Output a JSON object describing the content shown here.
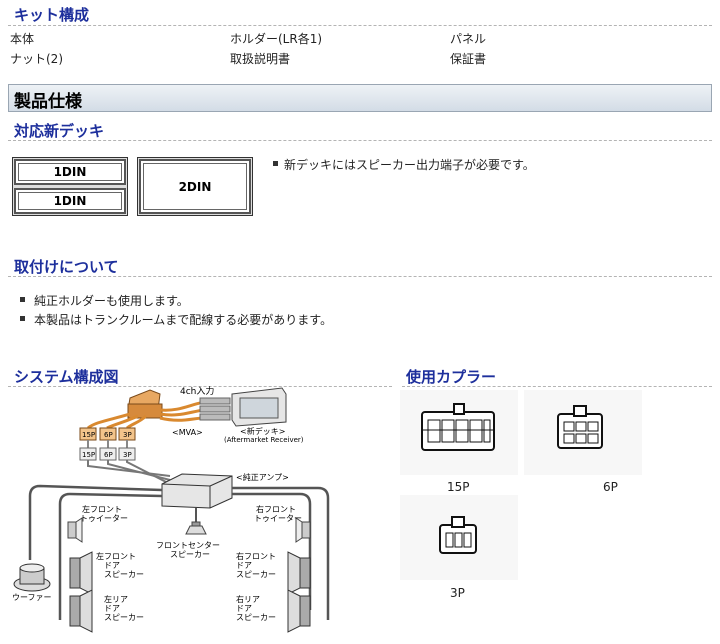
{
  "kit": {
    "title": "キット構成",
    "items": [
      "本体",
      "ホルダー(LR各1)",
      "パネル",
      "ナット(2)",
      "取扱説明書",
      "保証書"
    ]
  },
  "spec": {
    "title": "製品仕様"
  },
  "deck": {
    "title": "対応新デッキ",
    "din1_top": "1DIN",
    "din1_bottom": "1DIN",
    "din2": "2DIN",
    "note": "新デッキにはスピーカー出力端子が必要です。"
  },
  "mount": {
    "title": "取付けについて",
    "notes": [
      "純正ホルダーも使用します。",
      "本製品はトランクルームまで配線する必要があります。"
    ]
  },
  "system": {
    "title": "システム構成図",
    "labels": {
      "input": "4ch入力",
      "mva": "<MVA>",
      "new_deck": "<新デッキ>",
      "aftermarket": "(Aftermarket Receiver)",
      "amp": "<純正アンプ>",
      "p15a": "15P",
      "p6a": "6P",
      "p3a": "3P",
      "p15b": "15P",
      "p6b": "6P",
      "p3b": "3P",
      "left_tweeter_1": "左フロント",
      "left_tweeter_2": "トゥイーター",
      "right_tweeter_1": "右フロント",
      "right_tweeter_2": "トゥイーター",
      "center_1": "フロントセンター",
      "center_2": "スピーカー",
      "lfd_1": "左フロント",
      "lfd_2": "ドア",
      "lfd_3": "スピーカー",
      "rfd_1": "右フロント",
      "rfd_2": "ドア",
      "rfd_3": "スピーカー",
      "lrd_1": "左リア",
      "lrd_2": "ドア",
      "lrd_3": "スピーカー",
      "rrd_1": "右リア",
      "rrd_2": "ドア",
      "rrd_3": "スピーカー",
      "woofer": "ウーファー"
    }
  },
  "couplers": {
    "title": "使用カプラー",
    "items": [
      "15P",
      "6P",
      "3P"
    ]
  }
}
